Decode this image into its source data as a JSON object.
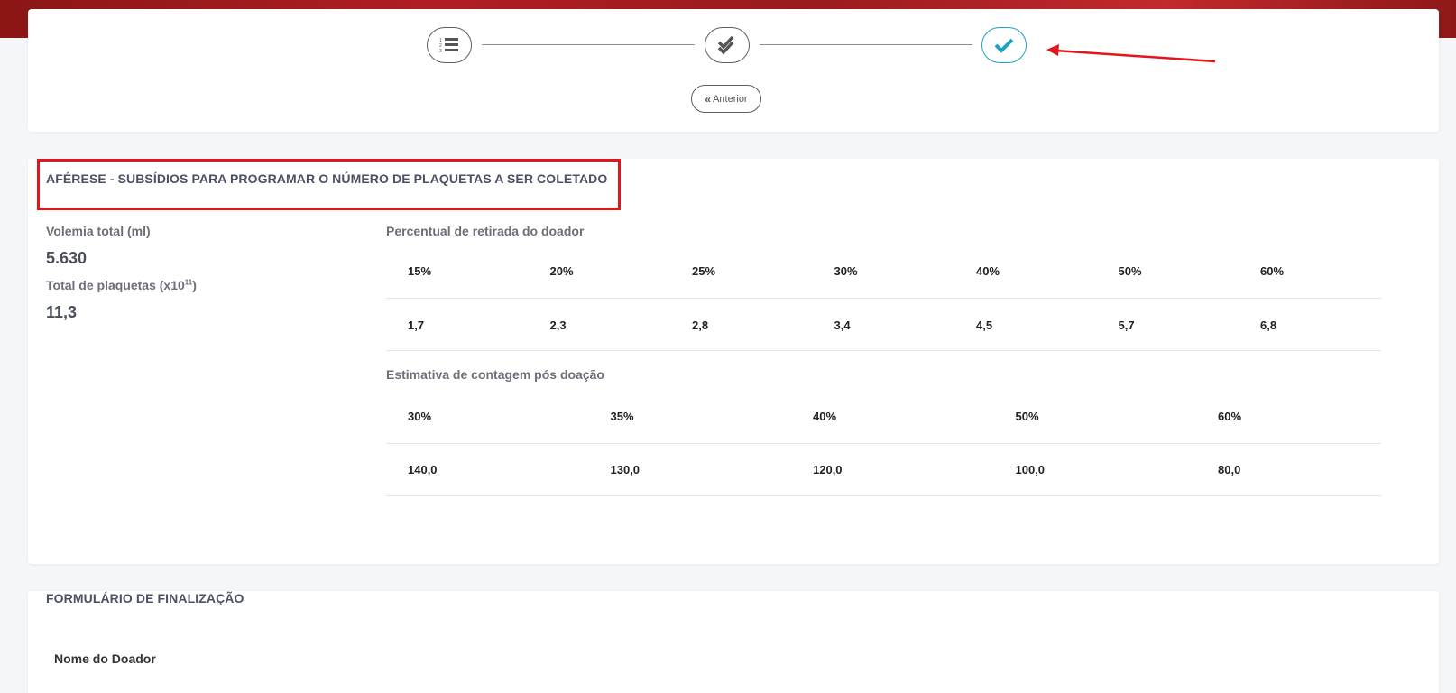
{
  "stepper": {
    "steps": [
      {
        "icon": "numbered-list-icon"
      },
      {
        "icon": "double-check-icon"
      },
      {
        "icon": "check-icon",
        "active": true
      }
    ],
    "prev_label": "Anterior"
  },
  "apheresis": {
    "title": "AFÉRESE - SUBSÍDIOS PARA PROGRAMAR O NÚMERO DE PLAQUETAS A SER COLETADO",
    "volemia_label": "Volemia total (ml)",
    "volemia_value": "5.630",
    "platelets_label": "Total de plaquetas (x10",
    "platelets_exp": "11",
    "platelets_label_end": ")",
    "platelets_value": "11,3",
    "withdrawal": {
      "title": "Percentual de retirada do doador",
      "headers": [
        "15%",
        "20%",
        "25%",
        "30%",
        "40%",
        "50%",
        "60%"
      ],
      "values": [
        "1,7",
        "2,3",
        "2,8",
        "3,4",
        "4,5",
        "5,7",
        "6,8"
      ]
    },
    "estimate": {
      "title": "Estimativa de contagem pós doação",
      "headers": [
        "30%",
        "35%",
        "40%",
        "50%",
        "60%"
      ],
      "values": [
        "140,0",
        "130,0",
        "120,0",
        "100,0",
        "80,0"
      ]
    }
  },
  "form": {
    "title": "FORMULÁRIO DE FINALIZAÇÃO",
    "donor_name_label": "Nome do Doador"
  },
  "colors": {
    "accent": "#1ba3bf",
    "annotation": "#e4141b",
    "banner": "#b01e24"
  }
}
